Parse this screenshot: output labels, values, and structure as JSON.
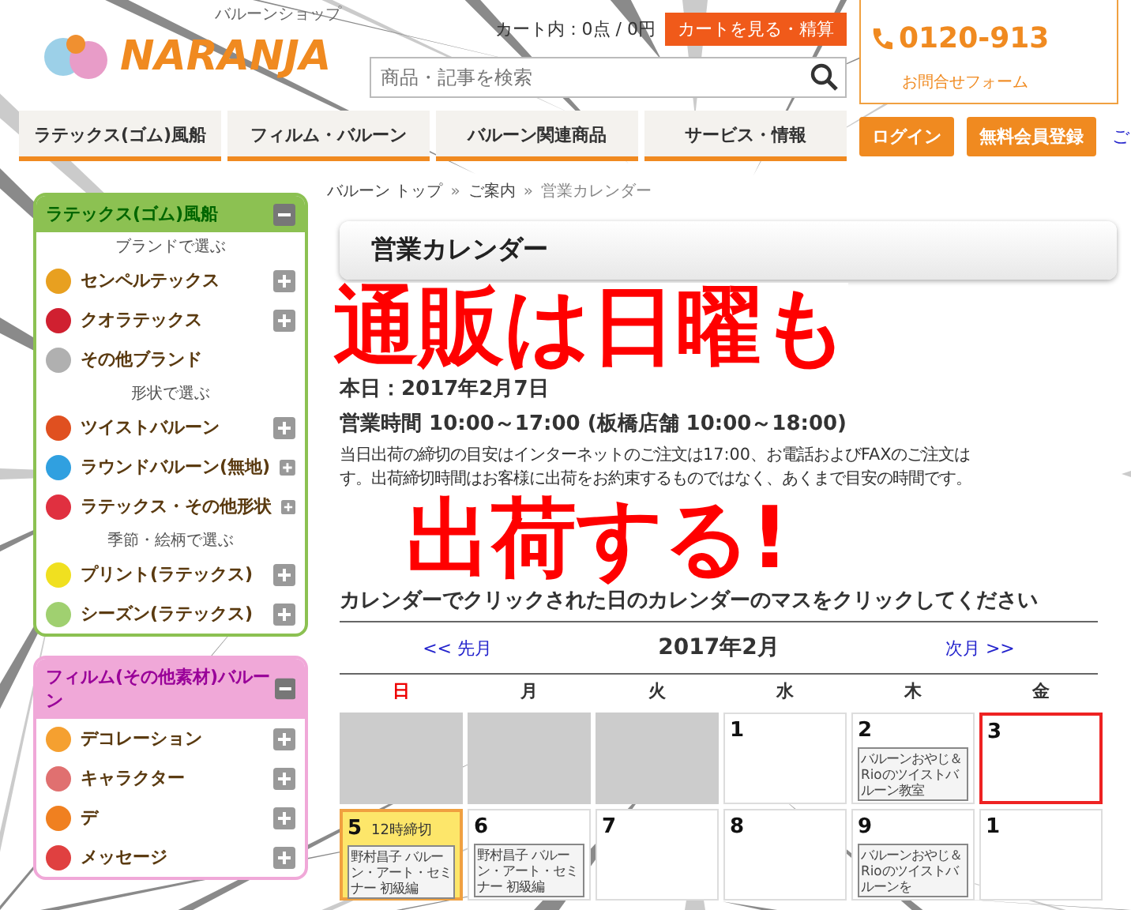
{
  "header": {
    "tagline": "バルーンショップ",
    "logo": "NARANJA",
    "cart_text": "カート内：0点 / 0円",
    "cart_button": "カートを見る・精算",
    "search": {
      "placeholder": "商品・記事を検索"
    },
    "phone": "0120-913",
    "contact_link": "お問合せフォーム"
  },
  "nav": {
    "tabs": [
      {
        "label": "ラテックス(ゴム)風船"
      },
      {
        "label": "フィルム・バルーン"
      },
      {
        "label": "バルーン関連商品"
      },
      {
        "label": "サービス・情報"
      }
    ],
    "buttons": [
      "ログイン",
      "無料会員登録"
    ],
    "link": "ご"
  },
  "sidebar": [
    {
      "title": "ラテックス(ゴム)風船",
      "color": "#8cc152",
      "items": [
        {
          "kind": "heading",
          "label": "ブランドで選ぶ"
        },
        {
          "kind": "item",
          "label": "センペルテックス",
          "color": "#e8a020",
          "expandable": true
        },
        {
          "kind": "item",
          "label": "クオラテックス",
          "color": "#d02030",
          "expandable": true
        },
        {
          "kind": "item",
          "label": "その他ブランド",
          "color": "#b0b0b0",
          "expandable": false
        },
        {
          "kind": "heading",
          "label": "形状で選ぶ"
        },
        {
          "kind": "item",
          "label": "ツイストバルーン",
          "color": "#e05020",
          "expandable": true
        },
        {
          "kind": "item",
          "label": "ラウンドバルーン(無地)",
          "color": "#30a0e0",
          "expandable": true
        },
        {
          "kind": "item",
          "label": "ラテックス・その他形状",
          "color": "#e03040",
          "expandable": true
        },
        {
          "kind": "heading",
          "label": "季節・絵柄で選ぶ"
        },
        {
          "kind": "item",
          "label": "プリント(ラテックス)",
          "color": "#f0e020",
          "expandable": true
        },
        {
          "kind": "item",
          "label": "シーズン(ラテックス)",
          "color": "#a0d070",
          "expandable": true
        }
      ]
    },
    {
      "title": "フィルム(その他素材)バルーン",
      "color": "#f0a8d8",
      "items": [
        {
          "kind": "item",
          "label": "デコレーション",
          "color": "#f5a030",
          "expandable": true
        },
        {
          "kind": "item",
          "label": "キャラクター",
          "color": "#e07070",
          "expandable": true
        },
        {
          "kind": "item",
          "label": "デ",
          "color": "#f08020",
          "expandable": true
        },
        {
          "kind": "item",
          "label": "メッセージ",
          "color": "#e04040",
          "expandable": true
        }
      ]
    }
  ],
  "main": {
    "breadcrumb": [
      {
        "kind": "link",
        "label": "バルーン トップ"
      },
      {
        "kind": "separator",
        "label": "»"
      },
      {
        "kind": "link",
        "label": "ご案内"
      },
      {
        "kind": "separator",
        "label": "»"
      },
      {
        "kind": "current",
        "label": "営業カレンダー"
      }
    ],
    "title": "営業カレンダー",
    "today": "本日：2017年2月7日",
    "hours": "営業時間 10:00～17:00 (板橋店舗 10:00～18:00)",
    "notes": [
      "当日出荷の締切の目安はインターネットのご注文は17:00、お電話およびFAXのご注文は",
      "す。出荷締切時間はお客様に出荷をお約束するものではなく、あくまで目安の時間です。"
    ],
    "instruction": "カレンダーでクリックされた日のカレンダーのマスをクリックしてください",
    "calendar": {
      "prev": "<< 先月",
      "month": "2017年2月",
      "next": "次月 >>",
      "weekdays": [
        {
          "label": "日",
          "holiday": true
        },
        {
          "label": "月",
          "holiday": false
        },
        {
          "label": "火",
          "holiday": false
        },
        {
          "label": "水",
          "holiday": false
        },
        {
          "label": "木",
          "holiday": false
        },
        {
          "label": "金",
          "holiday": false
        }
      ],
      "weeks": [
        [
          {
            "kind": "empty"
          },
          {
            "kind": "empty"
          },
          {
            "kind": "empty"
          },
          {
            "kind": "day",
            "day": "1"
          },
          {
            "kind": "day",
            "day": "2",
            "event": "バルーンおやじ＆Rioのツイストバルーン教室"
          },
          {
            "kind": "outlined",
            "day": "3"
          }
        ],
        [
          {
            "kind": "highlighted",
            "day": "5",
            "note": "12時締切",
            "event": "野村昌子 バルーン・アート・セミナー 初級編"
          },
          {
            "kind": "day",
            "day": "6",
            "event": "野村昌子 バルーン・アート・セミナー 初級編"
          },
          {
            "kind": "day",
            "day": "7"
          },
          {
            "kind": "day",
            "day": "8"
          },
          {
            "kind": "day",
            "day": "9",
            "event": "バルーンおやじ＆Rioのツイストバルーンを"
          },
          {
            "kind": "day",
            "day": "1"
          }
        ]
      ]
    }
  },
  "caption": [
    "通販は日曜も",
    "出荷する!"
  ]
}
